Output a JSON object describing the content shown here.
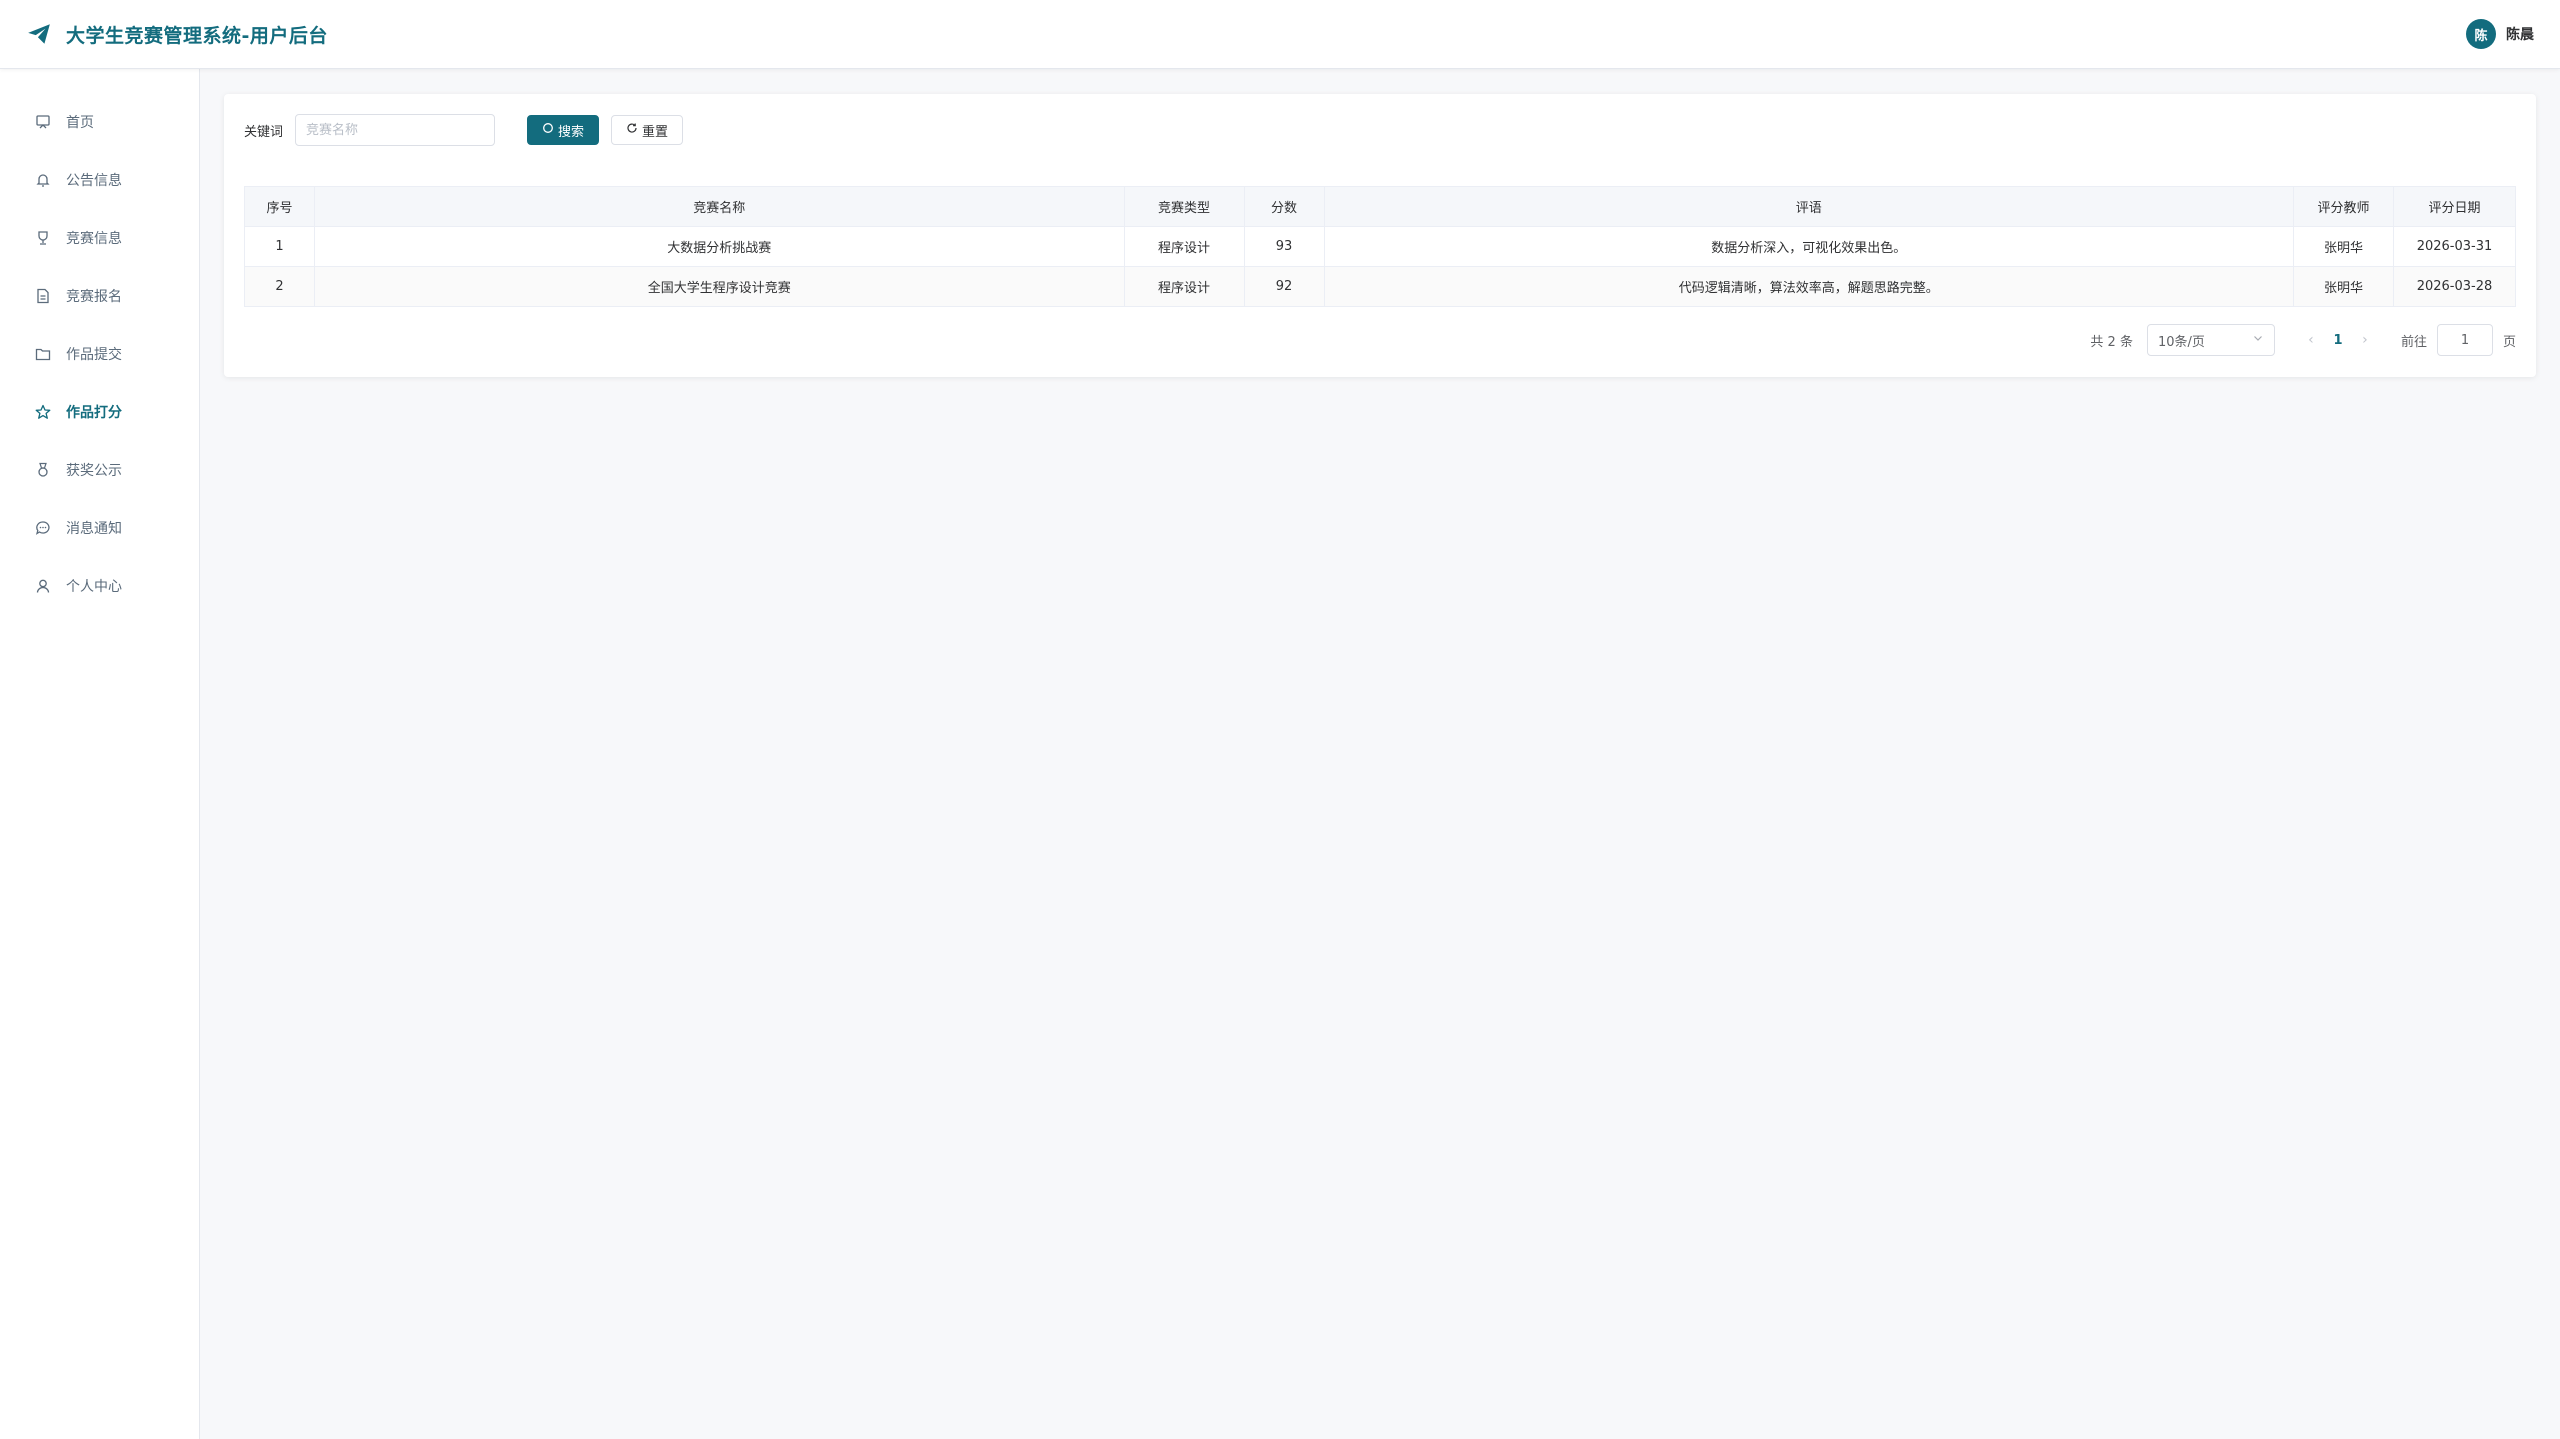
{
  "header": {
    "title": "大学生竞赛管理系统-用户后台",
    "user_avatar_text": "陈",
    "user_name": "陈晨"
  },
  "sidebar": {
    "items": [
      {
        "label": "首页",
        "icon": "home-icon"
      },
      {
        "label": "公告信息",
        "icon": "bell-icon"
      },
      {
        "label": "竞赛信息",
        "icon": "trophy-icon"
      },
      {
        "label": "竞赛报名",
        "icon": "document-icon"
      },
      {
        "label": "作品提交",
        "icon": "folder-icon"
      },
      {
        "label": "作品打分",
        "icon": "star-icon",
        "active": true
      },
      {
        "label": "获奖公示",
        "icon": "medal-icon"
      },
      {
        "label": "消息通知",
        "icon": "chat-icon"
      },
      {
        "label": "个人中心",
        "icon": "user-icon"
      }
    ]
  },
  "search": {
    "label": "关键词",
    "placeholder": "竞赛名称",
    "search_button": "搜索",
    "reset_button": "重置"
  },
  "table": {
    "headers": [
      "序号",
      "竞赛名称",
      "竞赛类型",
      "分数",
      "评语",
      "评分教师",
      "评分日期"
    ],
    "rows": [
      [
        "1",
        "大数据分析挑战赛",
        "程序设计",
        "93",
        "数据分析深入，可视化效果出色。",
        "张明华",
        "2026-03-31"
      ],
      [
        "2",
        "全国大学生程序设计竞赛",
        "程序设计",
        "92",
        "代码逻辑清晰，算法效率高，解题思路完整。",
        "张明华",
        "2026-03-28"
      ]
    ]
  },
  "pagination": {
    "total_text": "共 2 条",
    "page_size": "10条/页",
    "current_page": "1",
    "goto_label": "前往",
    "goto_value": "1",
    "goto_suffix": "页"
  },
  "colors": {
    "accent": "#136c7e",
    "background": "#f7f8fa"
  }
}
